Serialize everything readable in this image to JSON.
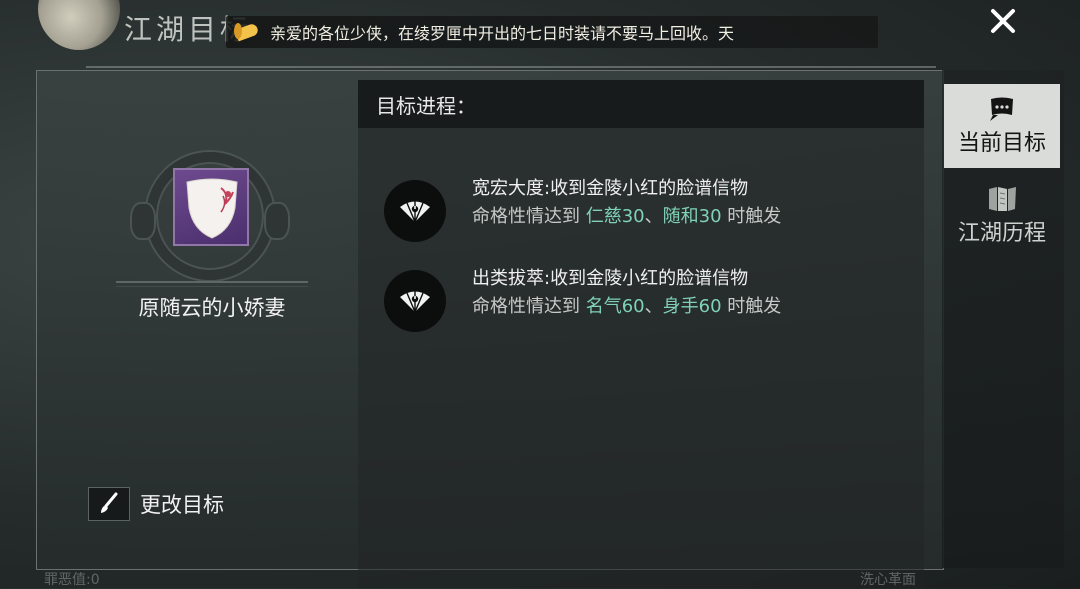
{
  "window": {
    "title": "江湖目标"
  },
  "announcement": {
    "text": "亲爱的各位少侠，在绫罗匣中开出的七日时装请不要马上回收。天"
  },
  "character": {
    "name": "原随云的小娇妻"
  },
  "actions": {
    "change_goal_label": "更改目标"
  },
  "panel": {
    "header": "目标进程：",
    "goals": [
      {
        "title": "宽宏大度:收到金陵小红的脸谱信物",
        "prefix": "命格性情达到",
        "req1": "仁慈30",
        "sep": "、",
        "req2": "随和30",
        "suffix": "时触发"
      },
      {
        "title": "出类拔萃:收到金陵小红的脸谱信物",
        "prefix": "命格性情达到",
        "req1": "名气60",
        "sep": "、",
        "req2": "身手60",
        "suffix": "时触发"
      }
    ]
  },
  "sidebar": {
    "tabs": [
      {
        "label": "当前目标",
        "icon": "scroll-icon",
        "active": true
      },
      {
        "label": "江湖历程",
        "icon": "open-scroll-icon",
        "active": false
      }
    ]
  },
  "bottom": {
    "left_text": "罪恶值:0",
    "right_text": "洗心革面"
  },
  "colors": {
    "highlight": "#7fd2b5",
    "active_tab_bg": "#d9dcd8",
    "horn": "#f3c24b"
  }
}
